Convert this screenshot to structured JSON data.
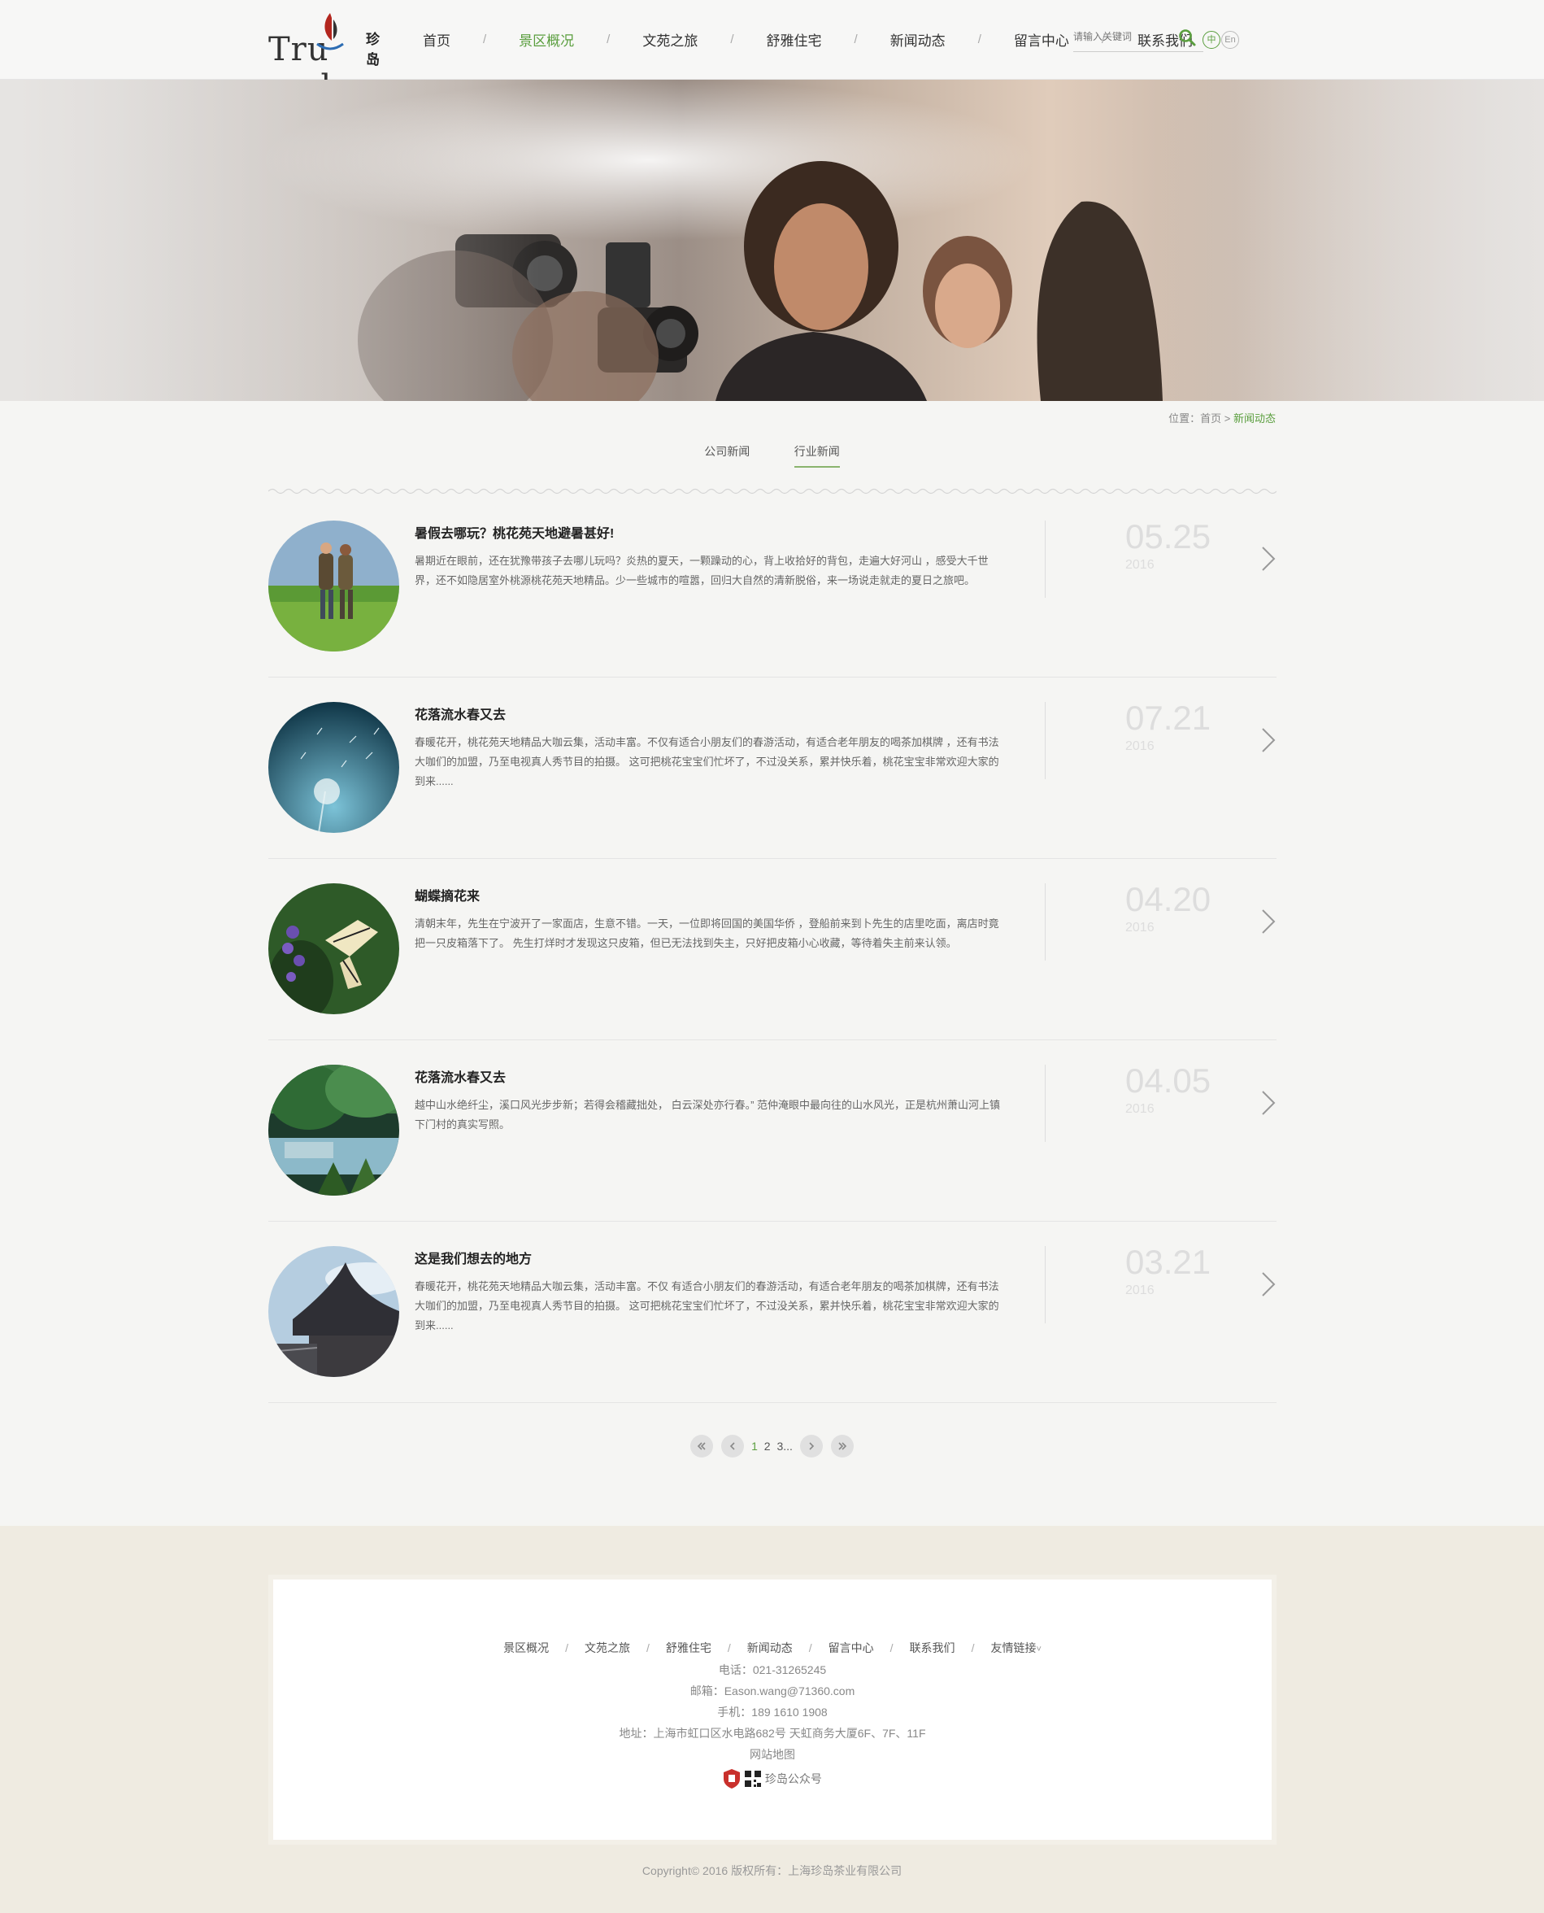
{
  "header": {
    "logo_text": "Tru  and",
    "logo_cn": "珍岛",
    "nav": [
      {
        "label": "首页"
      },
      {
        "label": "景区概况"
      },
      {
        "label": "文苑之旅"
      },
      {
        "label": "舒雅住宅"
      },
      {
        "label": "新闻动态"
      },
      {
        "label": "留言中心"
      },
      {
        "label": "联系我们"
      }
    ],
    "nav_separator": "/",
    "active_nav": "景区概况",
    "search_placeholder": "请输入关键词",
    "lang_cn": "中",
    "lang_en": "En"
  },
  "breadcrumb": {
    "prefix": "位置：",
    "home": "首页",
    "separator": " > ",
    "current": "新闻动态"
  },
  "tabs": [
    {
      "label": "公司新闻",
      "active": false
    },
    {
      "label": "行业新闻",
      "active": true
    }
  ],
  "news": [
    {
      "title": "暑假去哪玩？桃花苑天地避暑甚好!",
      "summary": "暑期近在眼前，还在犹豫带孩子去哪儿玩吗？炎热的夏天，一颗躁动的心，背上收拾好的背包，走遍大好河山 ，感受大千世界，还不如隐居室外桃源桃花苑天地精品。少一些城市的喧嚣，回归大自然的清新脱俗，来一场说走就走的夏日之旅吧。",
      "date": "05.25",
      "year": "2016",
      "thumb": "hikers-thumb"
    },
    {
      "title": "花落流水春又去",
      "summary": "春暖花开，桃花苑天地精品大咖云集，活动丰富。不仅有适合小朋友们的春游活动，有适合老年朋友的喝茶加棋牌 ，还有书法大咖们的加盟，乃至电视真人秀节目的拍摄。 这可把桃花宝宝们忙坏了，不过没关系，累并快乐着，桃花宝宝非常欢迎大家的到来......",
      "date": "07.21",
      "year": "2016",
      "thumb": "dandelion-thumb"
    },
    {
      "title": "蝴蝶摘花来",
      "summary": "清朝末年，先生在宁波开了一家面店，生意不错。一天，一位即将回国的美国华侨 ，登船前来到卜先生的店里吃面，离店时竟把一只皮箱落下了。 先生打烊时才发现这只皮箱，但已无法找到失主，只好把皮箱小心收藏，等待着失主前来认领。",
      "date": "04.20",
      "year": "2016",
      "thumb": "butterfly-thumb"
    },
    {
      "title": "花落流水春又去",
      "summary": "越中山水绝纤尘，溪口风光步步新；若得会稽藏拙处， 白云深处亦行春。” 范仲淹眼中最向往的山水风光，正是杭州萧山河上镇下门村的真实写照。",
      "date": "04.05",
      "year": "2016",
      "thumb": "river-thumb"
    },
    {
      "title": "这是我们想去的地方",
      "summary": "春暖花开，桃花苑天地精品大咖云集，活动丰富。不仅 有适合小朋友们的春游活动，有适合老年朋友的喝茶加棋牌，还有书法大咖们的加盟，乃至电视真人秀节目的拍摄。 这可把桃花宝宝们忙坏了，不过没关系，累并快乐着，桃花宝宝非常欢迎大家的到来......",
      "date": "03.21",
      "year": "2016",
      "thumb": "pavilion-thumb"
    }
  ],
  "pager": {
    "pages": [
      "1",
      "2",
      "3..."
    ],
    "current": "1"
  },
  "footer": {
    "nav": [
      {
        "label": "景区概况"
      },
      {
        "label": "文苑之旅"
      },
      {
        "label": "舒雅住宅"
      },
      {
        "label": "新闻动态"
      },
      {
        "label": "留言中心"
      },
      {
        "label": "联系我们"
      },
      {
        "label": "友情链接"
      }
    ],
    "separator": "/",
    "dropdown_glyph": "˅",
    "phone": "电话：021-31265245",
    "email": "邮箱：Eason.wang@71360.com",
    "mobile": "手机：189 1610 1908",
    "address": "地址：上海市虹口区水电路682号 天虹商务大厦6F、7F、11F",
    "sitemap": "网站地图",
    "badge_text": "珍岛公众号",
    "copyright": "Copyright© 2016 版权所有：上海珍岛茶业有限公司"
  },
  "colors": {
    "accent": "#5a9e3e",
    "date_gray": "#dddddd",
    "footer_bg": "#efebe1"
  }
}
